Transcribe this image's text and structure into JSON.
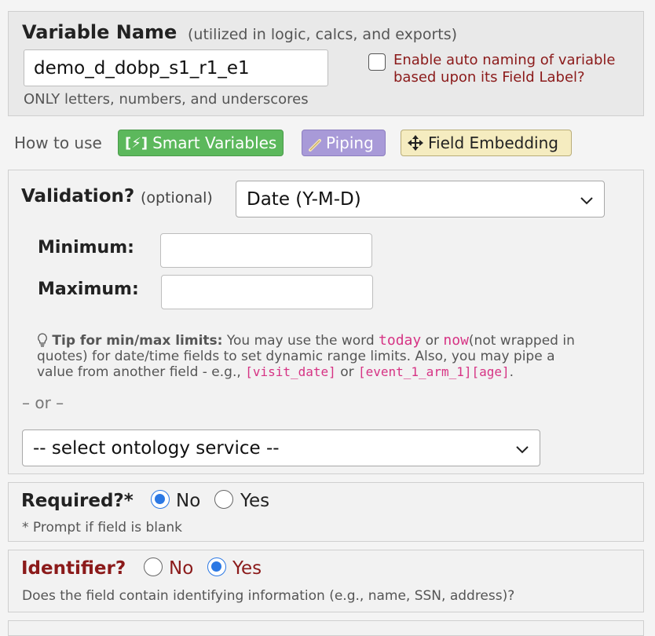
{
  "variable_section": {
    "title": "Variable Name",
    "subtitle": "(utilized in logic, calcs, and exports)",
    "value": "demo_d_dobp_s1_r1_e1",
    "hint": "ONLY letters, numbers, and underscores",
    "auto_naming_line1": "Enable auto naming of variable",
    "auto_naming_line2": "based upon its Field Label?"
  },
  "how_to_use": {
    "label": "How to use",
    "smart_variables_icon": "[⚡]",
    "smart_variables": "Smart Variables",
    "piping": "Piping",
    "field_embedding": "Field Embedding"
  },
  "validation": {
    "label": "Validation?",
    "optional": "(optional)",
    "selected": "Date (Y-M-D)",
    "minimum_label": "Minimum:",
    "maximum_label": "Maximum:",
    "minimum_value": "",
    "maximum_value": "",
    "tip_title": "Tip for min/max limits:",
    "tip_text1": "You may use the word",
    "tip_word_today": "today",
    "tip_or": "or",
    "tip_word_now": "now",
    "tip_text2": "(not wrapped in",
    "tip_line2": "quotes) for date/time fields to set dynamic range limits. Also, you may pipe a",
    "tip_line3": "value from another field - e.g.,",
    "tip_example1": "[visit_date]",
    "tip_or2": "or",
    "tip_example2": "[event_1_arm_1][age]",
    "tip_period": ".",
    "or_divider": "– or –",
    "ontology_selected": "-- select ontology service --"
  },
  "required": {
    "label": "Required?*",
    "no": "No",
    "yes": "Yes",
    "selected": "No",
    "note": "* Prompt if field is blank"
  },
  "identifier": {
    "label": "Identifier?",
    "no": "No",
    "yes": "Yes",
    "selected": "Yes",
    "note": "Does the field contain identifying information (e.g., name, SSN, address)?"
  },
  "colors": {
    "dark_red": "#8b1a1a",
    "smart_variables_bg": "#5cb85c",
    "piping_bg": "#a89ad8",
    "field_embedding_bg": "#f5ecc0",
    "radio_blue": "#2b78e4",
    "code_pink": "#d63384"
  }
}
